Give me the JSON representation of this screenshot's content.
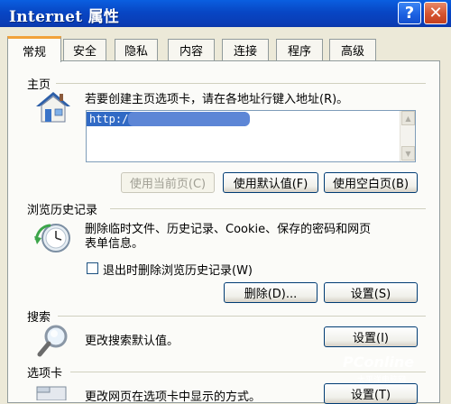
{
  "window": {
    "title": "Internet 属性",
    "help": "?",
    "close": "✕"
  },
  "tabs": [
    "常规",
    "安全",
    "隐私",
    "内容",
    "连接",
    "程序",
    "高级"
  ],
  "homepage": {
    "heading": "主页",
    "instruction": "若要创建主页选项卡，请在各地址行键入地址(R)。",
    "address": "http:/",
    "buttons": {
      "use_current": "使用当前页(C)",
      "use_default": "使用默认值(F)",
      "use_blank": "使用空白页(B)"
    }
  },
  "history": {
    "heading": "浏览历史记录",
    "description_line1": "删除临时文件、历史记录、Cookie、保存的密码和网页",
    "description_line2": "表单信息。",
    "checkbox_label": "退出时删除浏览历史记录(W)",
    "delete_button": "删除(D)...",
    "settings_button": "设置(S)"
  },
  "search": {
    "heading": "搜索",
    "description": "更改搜索默认值。",
    "settings_button": "设置(I)"
  },
  "tabs_section": {
    "heading": "选项卡",
    "description": "更改网页在选项卡中显示的方式。",
    "settings_button": "设置(T)"
  },
  "watermark": {
    "brand": "PConline",
    "sub": "太平洋电脑网"
  },
  "colors": {
    "titlebar": "#0846C4",
    "tab_accent": "#F1A23A",
    "face": "#ECE9D8"
  }
}
